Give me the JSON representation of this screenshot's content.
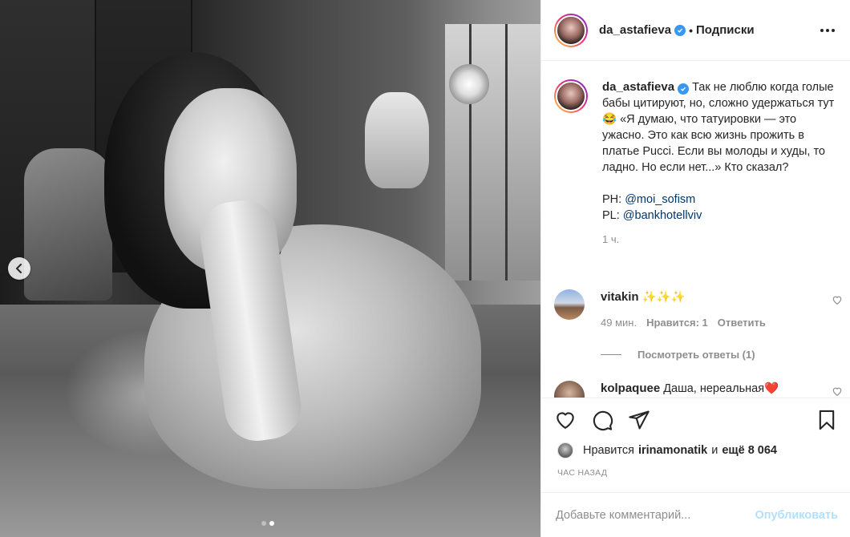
{
  "header": {
    "username": "da_astafieva",
    "separator": "•",
    "follow_label": "Подписки"
  },
  "caption": {
    "username": "da_astafieva",
    "text": "Так не люблю когда голые бабы цитируют, но, сложно удержаться тут😂 «Я думаю, что татуировки — это ужасно. Это как всю жизнь прожить в платье Pucci. Если вы молоды и худы, то ладно. Но если нет...» Кто сказал?",
    "ph_label": "PH: ",
    "ph_link": "@moi_sofism",
    "pl_label": "PL: ",
    "pl_link": "@bankhotellviv",
    "time": "1 ч."
  },
  "comments": [
    {
      "username": "vitakin",
      "text": "✨✨✨",
      "time": "49 мин.",
      "likes": "Нравится: 1",
      "reply": "Ответить"
    },
    {
      "username": "kolpaquee",
      "text": "Даша, нереальная❤️"
    }
  ],
  "view_replies": "Посмотреть ответы (1)",
  "likes": {
    "prefix": "Нравится",
    "user": "irinamonatik",
    "and": "и",
    "count": "ещё 8 064"
  },
  "timestamp": "ЧАС НАЗАД",
  "add_comment": {
    "placeholder": "Добавьте комментарий...",
    "publish": "Опубликовать"
  },
  "carousel": {
    "total": 2,
    "active": 2
  },
  "colors": {
    "link": "#00376b",
    "verified": "#3897f0",
    "publish_disabled": "#b2dffc",
    "muted": "#8e8e8e"
  },
  "icons": [
    "chevron-left-icon",
    "verified-icon",
    "more-icon",
    "heart-icon",
    "comment-icon",
    "share-icon",
    "bookmark-icon"
  ]
}
